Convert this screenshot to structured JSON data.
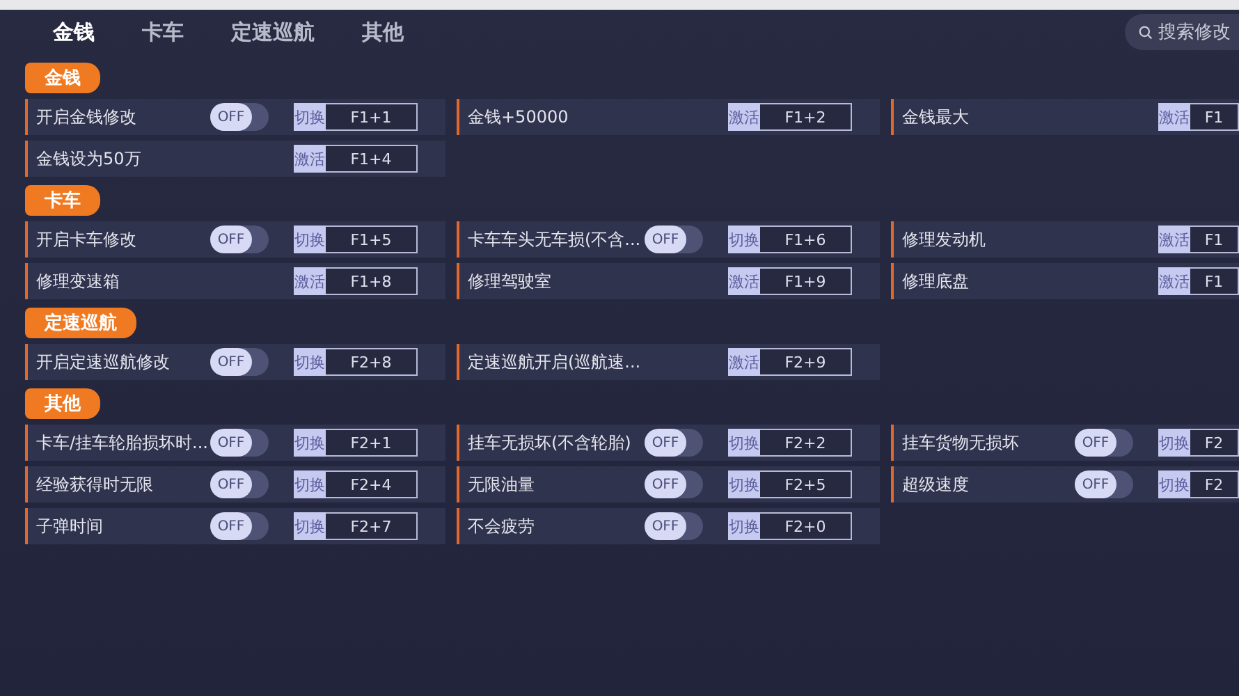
{
  "tabs": [
    {
      "label": "金钱",
      "selected": true
    },
    {
      "label": "卡车",
      "selected": false
    },
    {
      "label": "定速巡航",
      "selected": false
    },
    {
      "label": "其他",
      "selected": false
    }
  ],
  "search": {
    "placeholder": "搜索修改"
  },
  "sections": [
    {
      "title": "金钱",
      "items": [
        {
          "kind": "toggle",
          "label": "开启金钱修改",
          "toggle": {
            "label": "OFF",
            "on": false
          },
          "mode": "切换",
          "hotkey": "F1+1"
        },
        {
          "kind": "button",
          "label": "金钱+50000",
          "mode": "激活",
          "hotkey": "F1+2"
        },
        {
          "kind": "button",
          "label": "金钱最大",
          "mode": "激活",
          "hotkey": "F1"
        },
        {
          "kind": "button",
          "label": "金钱设为50万",
          "mode": "激活",
          "hotkey": "F1+4"
        }
      ]
    },
    {
      "title": "卡车",
      "items": [
        {
          "kind": "toggle",
          "label": "开启卡车修改",
          "toggle": {
            "label": "OFF",
            "on": false
          },
          "mode": "切换",
          "hotkey": "F1+5"
        },
        {
          "kind": "toggle",
          "label": "卡车车头无车损(不含...",
          "toggle": {
            "label": "OFF",
            "on": false
          },
          "mode": "切换",
          "hotkey": "F1+6"
        },
        {
          "kind": "button",
          "label": "修理发动机",
          "mode": "激活",
          "hotkey": "F1"
        },
        {
          "kind": "button",
          "label": "修理变速箱",
          "mode": "激活",
          "hotkey": "F1+8"
        },
        {
          "kind": "button",
          "label": "修理驾驶室",
          "mode": "激活",
          "hotkey": "F1+9"
        },
        {
          "kind": "button",
          "label": "修理底盘",
          "mode": "激活",
          "hotkey": "F1"
        }
      ]
    },
    {
      "title": "定速巡航",
      "items": [
        {
          "kind": "toggle",
          "label": "开启定速巡航修改",
          "toggle": {
            "label": "OFF",
            "on": false
          },
          "mode": "切换",
          "hotkey": "F2+8"
        },
        {
          "kind": "button",
          "label": "定速巡航开启(巡航速...",
          "mode": "激活",
          "hotkey": "F2+9"
        }
      ]
    },
    {
      "title": "其他",
      "items": [
        {
          "kind": "toggle",
          "label": "卡车/挂车轮胎损坏时...",
          "toggle": {
            "label": "OFF",
            "on": false
          },
          "mode": "切换",
          "hotkey": "F2+1"
        },
        {
          "kind": "toggle",
          "label": "挂车无损坏(不含轮胎)",
          "toggle": {
            "label": "OFF",
            "on": false
          },
          "mode": "切换",
          "hotkey": "F2+2"
        },
        {
          "kind": "toggle",
          "label": "挂车货物无损坏",
          "toggle": {
            "label": "OFF",
            "on": false
          },
          "mode": "切换",
          "hotkey": "F2"
        },
        {
          "kind": "toggle",
          "label": "经验获得时无限",
          "toggle": {
            "label": "OFF",
            "on": false
          },
          "mode": "切换",
          "hotkey": "F2+4"
        },
        {
          "kind": "toggle",
          "label": "无限油量",
          "toggle": {
            "label": "OFF",
            "on": false
          },
          "mode": "切换",
          "hotkey": "F2+5"
        },
        {
          "kind": "toggle",
          "label": "超级速度",
          "toggle": {
            "label": "OFF",
            "on": false
          },
          "mode": "切换",
          "hotkey": "F2"
        },
        {
          "kind": "toggle",
          "label": "子弹时间",
          "toggle": {
            "label": "OFF",
            "on": false
          },
          "mode": "切换",
          "hotkey": "F2+7"
        },
        {
          "kind": "toggle",
          "label": "不会疲劳",
          "toggle": {
            "label": "OFF",
            "on": false
          },
          "mode": "切换",
          "hotkey": "F2+0"
        }
      ]
    }
  ]
}
